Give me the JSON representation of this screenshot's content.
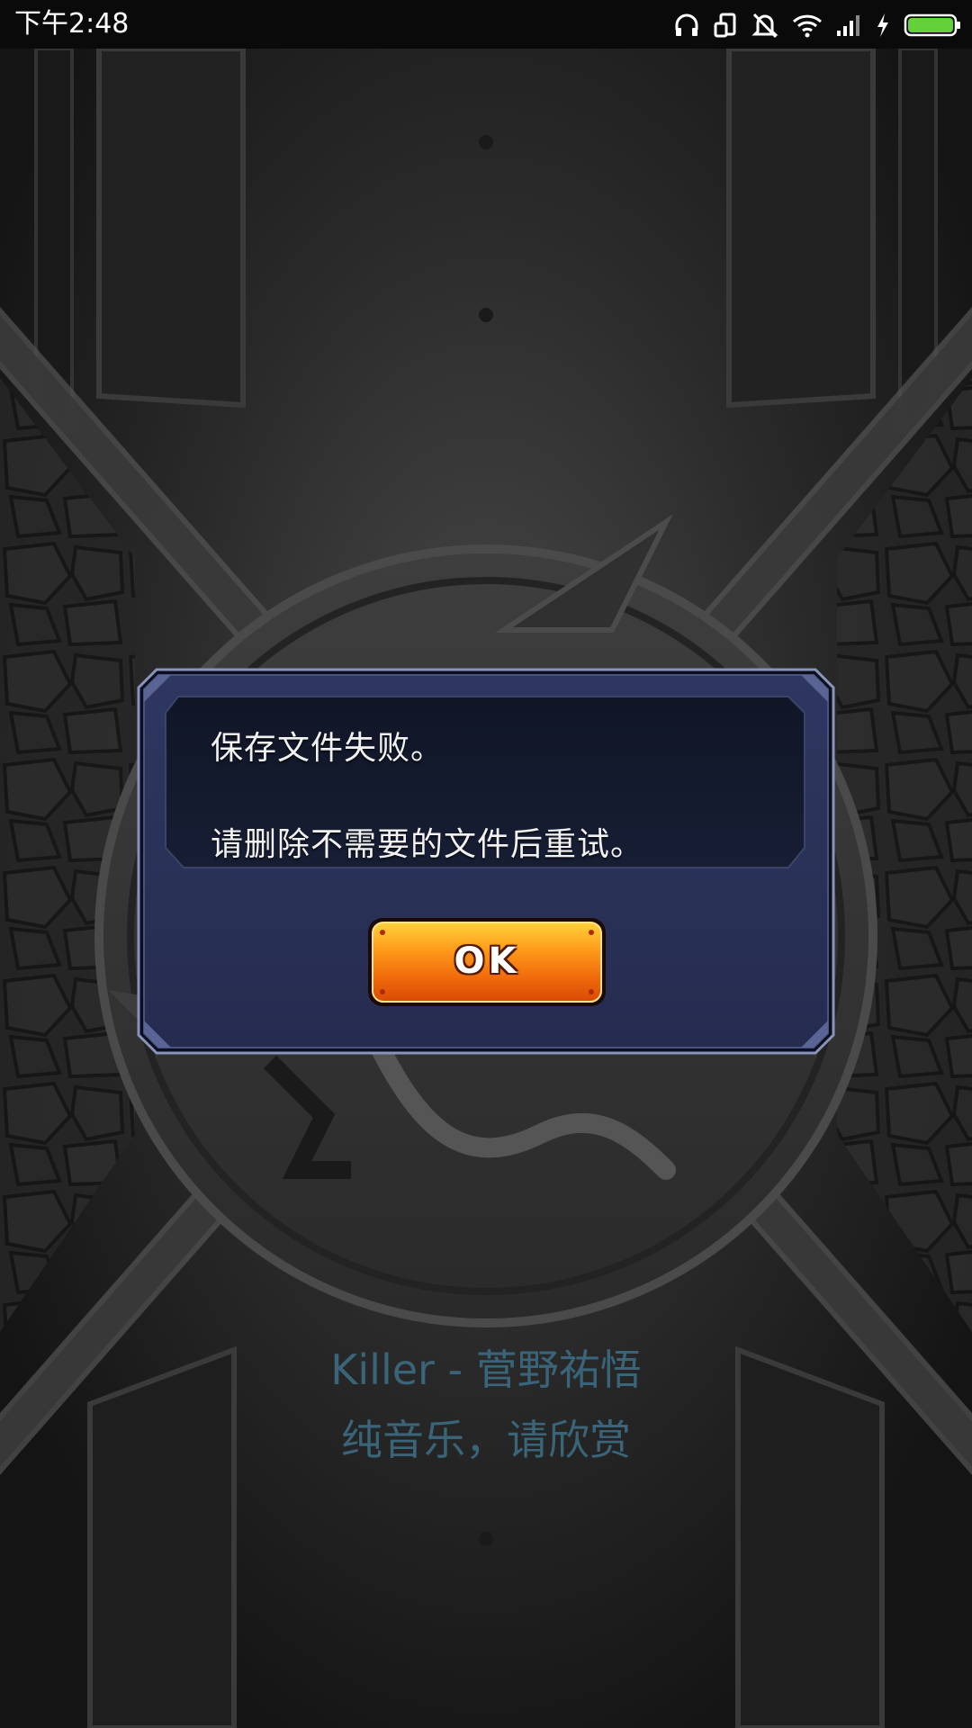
{
  "status_bar": {
    "time": "下午2:48",
    "icons": [
      "headphones-icon",
      "screen-rotation-icon",
      "silent-mode-icon",
      "wifi-icon",
      "cellular-signal-icon",
      "charging-bolt-icon",
      "battery-icon"
    ],
    "battery_level": 1.0,
    "battery_color": "#62d13a"
  },
  "dialog": {
    "message_line_1": "保存文件失败。",
    "message_line_2": "请删除不需要的文件后重试。",
    "ok_label": "OK",
    "frame_color": "#2a3158",
    "inner_color": "#141a2c",
    "button_color": "#f06a0c"
  },
  "lyrics": {
    "title": "Killer - 菅野祐悟",
    "subtitle": "纯音乐，请欣赏",
    "color": "#3a6478"
  }
}
